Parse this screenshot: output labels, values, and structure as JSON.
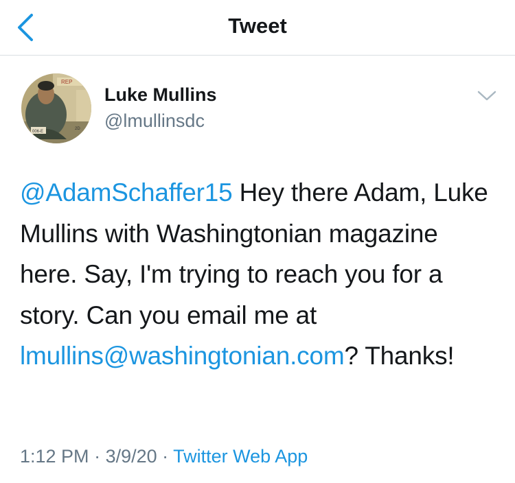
{
  "nav": {
    "title": "Tweet",
    "back_icon": "chevron-left-icon"
  },
  "author": {
    "display_name": "Luke Mullins",
    "handle": "@lmullinsdc",
    "avatar_icon": "profile-photo"
  },
  "more_icon": "chevron-down-icon",
  "tweet": {
    "mention": "@AdamSchaffer15",
    "text_before_email": " Hey there Adam, Luke Mullins with Washingtonian magazine here. Say, I'm trying to reach you for a story. Can you email me at ",
    "email": "lmullins@washingtonian.com",
    "text_after_email": "? Thanks!"
  },
  "meta": {
    "time": "1:12 PM",
    "separator_1": " · ",
    "date": "3/9/20",
    "separator_2": " · ",
    "source": "Twitter Web App"
  },
  "colors": {
    "accent": "#1b95e0",
    "secondary_text": "#657786",
    "primary_text": "#14171a",
    "divider": "#d9dee2"
  }
}
